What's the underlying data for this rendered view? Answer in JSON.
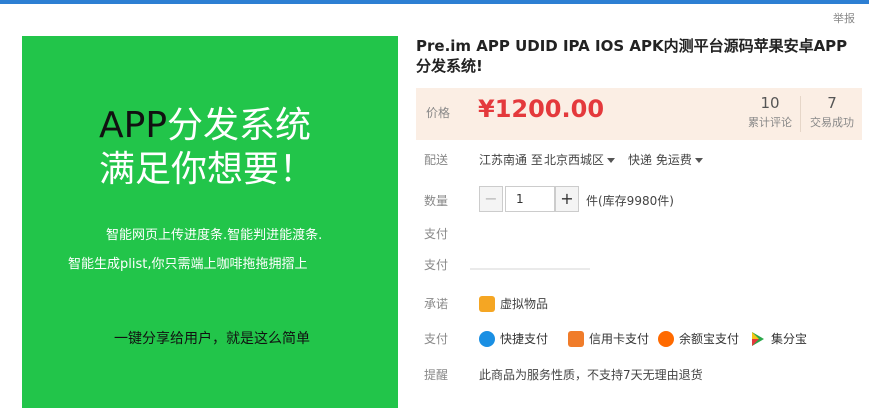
{
  "header": {
    "report_label": "举报"
  },
  "image_panel": {
    "hero_line1_prefix": "APP",
    "hero_line1_suffix": "分发系统",
    "hero_line2": "满足你想要！",
    "desc_line1": "智能网页上传进度条.智能判进能渡条.",
    "desc_line2": "智能生成plist,你只需端上咖啡拖拖拥摺上",
    "tagline": "一键分享给用户，就是这么简单",
    "bg_color": "#22c54a"
  },
  "product": {
    "title": "Pre.im APP UDID IPA IOS APK内测平台源码苹果安卓APP分发系统!"
  },
  "price": {
    "label": "价格",
    "value": "¥1200.00",
    "reviews_count": "10",
    "reviews_label": "累计评论",
    "sales_count": "7",
    "sales_label": "交易成功"
  },
  "shipping": {
    "label": "配送",
    "from": "江苏南通 至",
    "destination": "北京西城区",
    "method": "快递 免运费"
  },
  "quantity": {
    "label": "数量",
    "value": "1",
    "minus": "−",
    "plus": "+",
    "stock": "件(库存9980件)"
  },
  "rows": {
    "pay_label_1": "支付",
    "pay_label_2": "支付"
  },
  "promise": {
    "label": "承诺",
    "item": "虚拟物品"
  },
  "payment": {
    "label": "支付",
    "methods": [
      "快捷支付",
      "信用卡支付",
      "余额宝支付",
      "集分宝"
    ]
  },
  "reminder": {
    "label": "提醒",
    "text": "此商品为服务性质，不支持7天无理由退货"
  },
  "colors": {
    "accent": "#e4393c",
    "price_bg": "#fbeee4",
    "top_bar": "#2d7fd3"
  }
}
